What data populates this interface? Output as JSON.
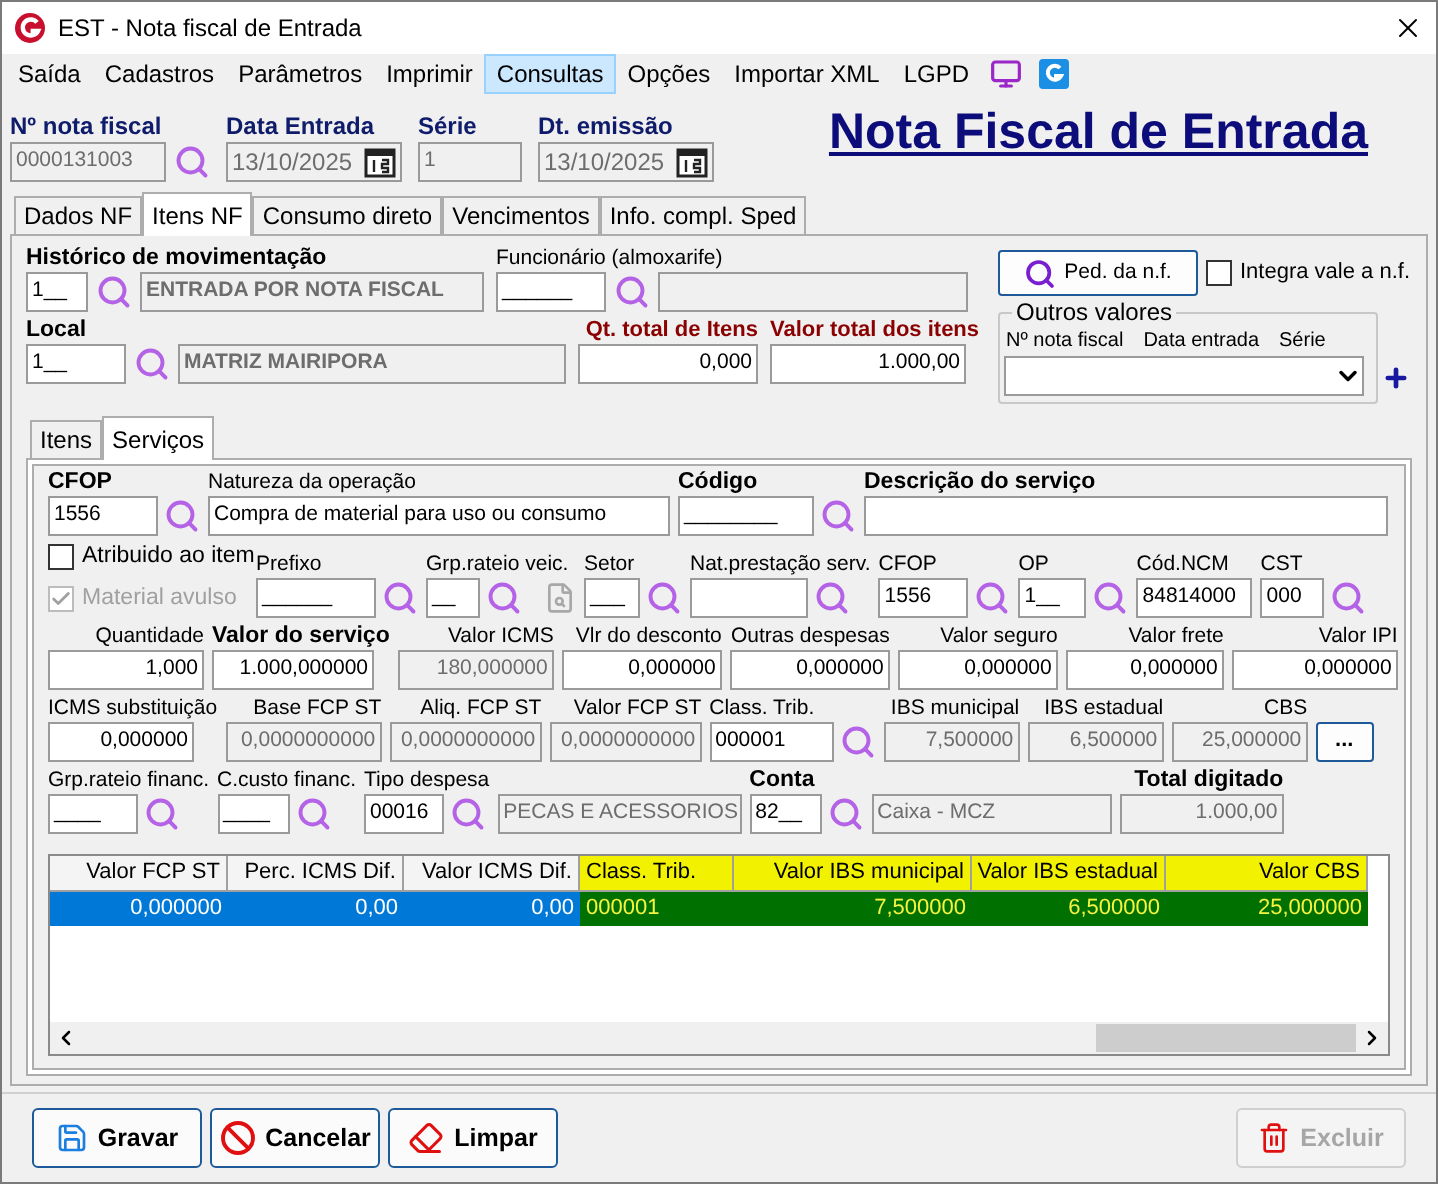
{
  "window": {
    "title": "EST - Nota fiscal de Entrada"
  },
  "menu": [
    {
      "label": "Saída",
      "selected": false
    },
    {
      "label": "Cadastros",
      "selected": false
    },
    {
      "label": "Parâmetros",
      "selected": false
    },
    {
      "label": "Imprimir",
      "selected": false
    },
    {
      "label": "Consultas",
      "selected": true
    },
    {
      "label": "Opções",
      "selected": false
    },
    {
      "label": "Importar XML",
      "selected": false
    },
    {
      "label": "LGPD",
      "selected": false
    }
  ],
  "header": {
    "fields": [
      {
        "label": "Nº nota fiscal",
        "value": "0000131003",
        "disabled": true,
        "kind": "lookup"
      },
      {
        "label": "Data Entrada",
        "value": "13/10/2025",
        "disabled": true,
        "kind": "date"
      },
      {
        "label": "Série",
        "value": "1",
        "disabled": true,
        "kind": "plain"
      },
      {
        "label": "Dt. emissão",
        "value": "13/10/2025",
        "disabled": true,
        "kind": "date"
      }
    ],
    "heading": "Nota Fiscal de Entrada"
  },
  "tabs": [
    {
      "label": "Dados NF",
      "selected": false
    },
    {
      "label": "Itens NF",
      "selected": true
    },
    {
      "label": "Consumo direto",
      "selected": false
    },
    {
      "label": "Vencimentos",
      "selected": false
    },
    {
      "label": "Info. compl. Sped",
      "selected": false
    }
  ],
  "historico": {
    "label": "Histórico de movimentação",
    "code": "1__",
    "description": "ENTRADA POR NOTA FISCAL"
  },
  "funcionario": {
    "label": "Funcionário (almoxarife)",
    "code": "______"
  },
  "local": {
    "label": "Local",
    "code": "1__",
    "description": "MATRIZ MAIRIPORA"
  },
  "totals": [
    {
      "label": "Qt. total de Itens",
      "value": "0,000"
    },
    {
      "label": "Valor total dos itens",
      "value": "1.000,00"
    }
  ],
  "ped_button": "Ped. da n.f.",
  "integra": {
    "label": "Integra vale a n.f.",
    "checked": false
  },
  "outros_valores": {
    "title": "Outros valores",
    "columns": [
      "Nº nota fiscal",
      "Data entrada",
      "Série"
    ]
  },
  "subtabs": [
    {
      "label": "Itens",
      "selected": false
    },
    {
      "label": "Serviços",
      "selected": true
    }
  ],
  "options": [
    {
      "label": "Atribuido ao item",
      "checked": false,
      "disabled": false
    },
    {
      "label": "Material avulso",
      "checked": true,
      "disabled": true
    }
  ],
  "rows": [
    {
      "fields": [
        {
          "label": "CFOP",
          "value": "1556",
          "bold": true,
          "disabled": false,
          "lookup": true,
          "kind": "text"
        },
        {
          "label": "Natureza da operação",
          "value": "Compra de material para uso ou consumo",
          "bold": false,
          "disabled": false,
          "lookup": false,
          "kind": "text"
        },
        {
          "label": "Código",
          "value": "________",
          "bold": true,
          "disabled": false,
          "lookup": true,
          "kind": "text"
        },
        {
          "label": "Descrição do serviço",
          "bold": true,
          "disabled": false,
          "lookup": false,
          "kind": "text"
        }
      ]
    },
    {
      "fields": [
        {
          "label": "Prefixo",
          "value": "______",
          "bold": false,
          "disabled": false,
          "lookup": true,
          "kind": "text"
        },
        {
          "label": "Grp.rateio veic.",
          "value": "__",
          "bold": false,
          "disabled": false,
          "lookup": true,
          "kind": "text"
        },
        {
          "label": "Setor",
          "value": "___",
          "bold": false,
          "disabled": false,
          "lookup": true,
          "kind": "text"
        },
        {
          "label": "Nat.prestação serv.",
          "bold": false,
          "disabled": false,
          "lookup": true,
          "kind": "text"
        },
        {
          "label": "CFOP",
          "value": "1556",
          "bold": false,
          "disabled": false,
          "lookup": true,
          "kind": "text"
        },
        {
          "label": "OP",
          "value": "1__",
          "bold": false,
          "disabled": false,
          "lookup": true,
          "kind": "text"
        },
        {
          "label": "Cód.NCM",
          "value": "84814000",
          "bold": false,
          "disabled": false,
          "lookup": false,
          "kind": "text"
        },
        {
          "label": "CST",
          "value": "000",
          "bold": false,
          "disabled": false,
          "lookup": true,
          "kind": "text"
        }
      ]
    },
    {
      "fields": [
        {
          "label": "Quantidade",
          "value": "1,000",
          "bold": false,
          "disabled": false,
          "lookup": false,
          "kind": "number"
        },
        {
          "label": "Valor do serviço",
          "value": "1.000,000000",
          "bold": true,
          "disabled": false,
          "lookup": false,
          "kind": "number"
        },
        {
          "label": "Valor ICMS",
          "value": "180,000000",
          "bold": false,
          "disabled": true,
          "lookup": false,
          "kind": "number"
        },
        {
          "label": "Vlr do desconto",
          "value": "0,000000",
          "bold": false,
          "disabled": false,
          "lookup": false,
          "kind": "number"
        },
        {
          "label": "Outras despesas",
          "value": "0,000000",
          "bold": false,
          "disabled": false,
          "lookup": false,
          "kind": "number"
        },
        {
          "label": "Valor seguro",
          "value": "0,000000",
          "bold": false,
          "disabled": false,
          "lookup": false,
          "kind": "number"
        },
        {
          "label": "Valor frete",
          "value": "0,000000",
          "bold": false,
          "disabled": false,
          "lookup": false,
          "kind": "number"
        },
        {
          "label": "Valor IPI",
          "value": "0,000000",
          "bold": false,
          "disabled": false,
          "lookup": false,
          "kind": "number"
        }
      ]
    },
    {
      "fields": [
        {
          "label": "ICMS substituição",
          "value": "0,000000",
          "bold": false,
          "disabled": false,
          "lookup": false,
          "kind": "number"
        },
        {
          "label": "Base FCP ST",
          "value": "0,0000000000",
          "bold": false,
          "disabled": true,
          "lookup": false,
          "kind": "number"
        },
        {
          "label": "Aliq. FCP ST",
          "value": "0,0000000000",
          "bold": false,
          "disabled": true,
          "lookup": false,
          "kind": "number"
        },
        {
          "label": "Valor FCP ST",
          "value": "0,0000000000",
          "bold": false,
          "disabled": true,
          "lookup": false,
          "kind": "number"
        },
        {
          "label": "Class. Trib.",
          "value": "000001",
          "bold": false,
          "disabled": false,
          "lookup": true,
          "kind": "text"
        },
        {
          "label": "IBS municipal",
          "value": "7,500000",
          "bold": false,
          "disabled": true,
          "lookup": false,
          "kind": "number"
        },
        {
          "label": "IBS estadual",
          "value": "6,500000",
          "bold": false,
          "disabled": true,
          "lookup": false,
          "kind": "number"
        },
        {
          "label": "CBS",
          "value": "25,000000",
          "bold": false,
          "disabled": true,
          "lookup": false,
          "kind": "number"
        }
      ]
    },
    {
      "fields": [
        {
          "label": "Grp.rateio financ.",
          "value": "____",
          "bold": false,
          "disabled": false,
          "lookup": true,
          "kind": "text"
        },
        {
          "label": "C.custo financ.",
          "value": "____",
          "bold": false,
          "disabled": false,
          "lookup": true,
          "kind": "text"
        },
        {
          "label": "Tipo despesa",
          "value": "00016",
          "bold": false,
          "disabled": false,
          "lookup": true,
          "kind": "text"
        },
        {
          "value": "PECAS E ACESSORIOS",
          "disabled": true,
          "lookup": false,
          "kind": "text"
        },
        {
          "label": "Conta",
          "value": "82__",
          "bold": true,
          "disabled": false,
          "lookup": true,
          "kind": "text"
        },
        {
          "value": "Caixa - MCZ",
          "disabled": true,
          "lookup": false,
          "kind": "text"
        },
        {
          "label": "Total digitado",
          "value": "1.000,00",
          "bold": true,
          "disabled": true,
          "lookup": false,
          "kind": "number"
        }
      ]
    }
  ],
  "more_button": "...",
  "table": {
    "columns": [
      {
        "label": "Valor FCP ST",
        "highlighted": false
      },
      {
        "label": "Perc. ICMS Dif.",
        "highlighted": false
      },
      {
        "label": "Valor ICMS Dif.",
        "highlighted": false
      },
      {
        "label": "Class. Trib.",
        "highlighted": true
      },
      {
        "label": "Valor IBS municipal",
        "highlighted": true
      },
      {
        "label": "Valor IBS estadual",
        "highlighted": true
      },
      {
        "label": "Valor CBS",
        "highlighted": true
      }
    ],
    "rows": [
      {
        "selected": true,
        "cells": [
          "0,000000",
          "0,00",
          "0,00",
          "000001",
          "7,500000",
          "6,500000",
          "25,000000"
        ]
      }
    ]
  },
  "buttons": [
    {
      "label": "Gravar",
      "kind": "save",
      "disabled": false
    },
    {
      "label": "Cancelar",
      "kind": "cancel",
      "disabled": false
    },
    {
      "label": "Limpar",
      "kind": "clear",
      "disabled": false
    },
    {
      "label": "Excluir",
      "kind": "delete",
      "disabled": true
    }
  ]
}
